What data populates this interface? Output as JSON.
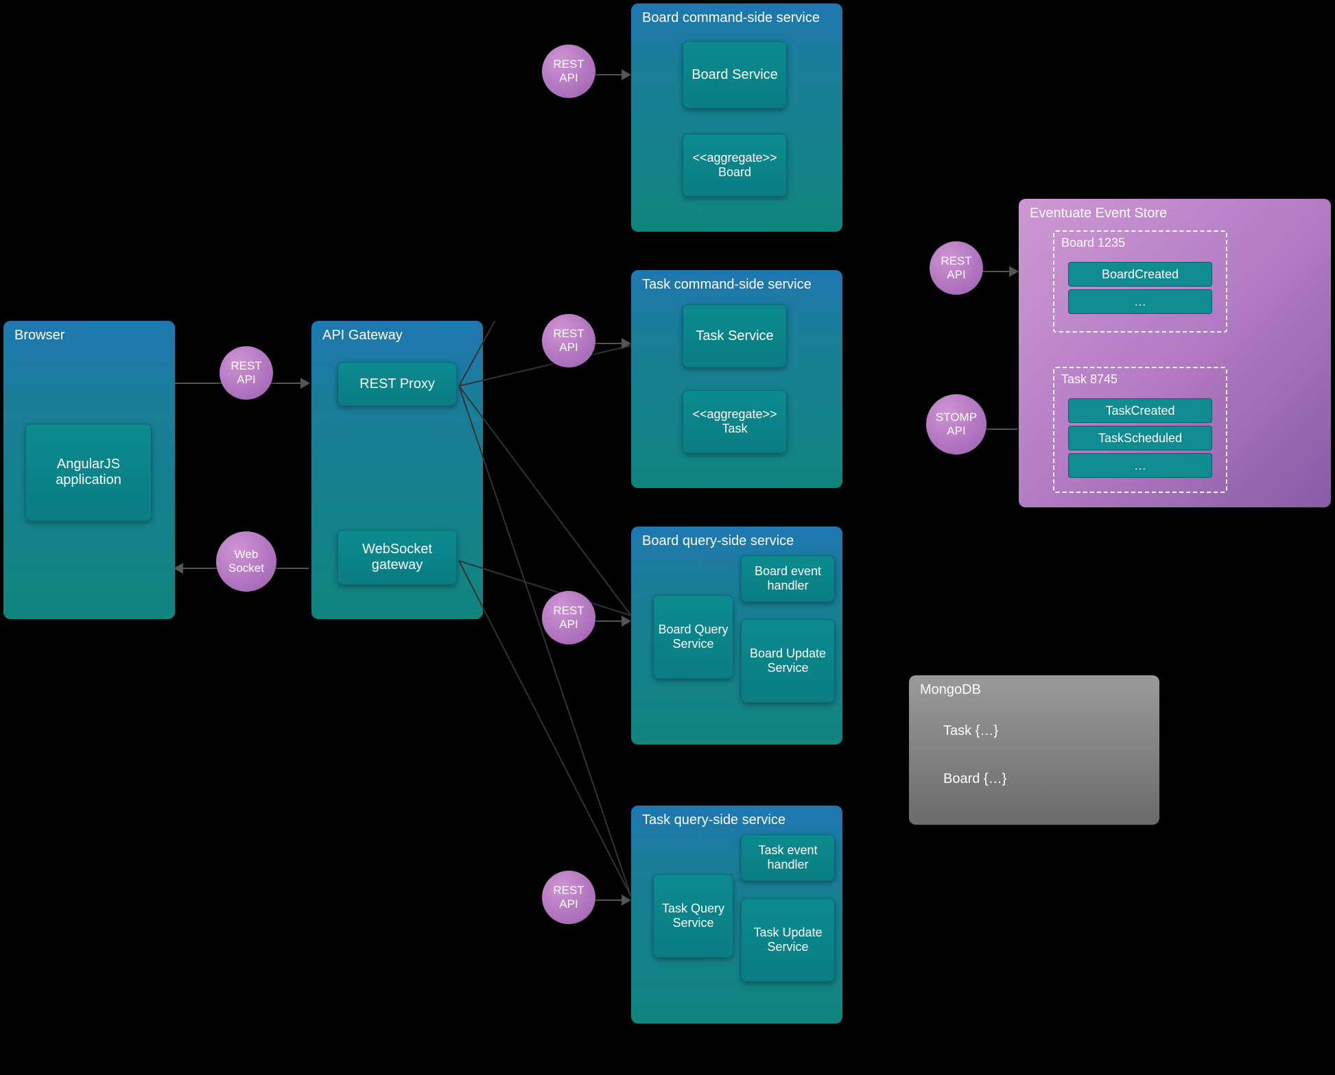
{
  "diagram": {
    "browser": {
      "title": "Browser",
      "app": "AngularJS application"
    },
    "gateway": {
      "title": "API Gateway",
      "rest_proxy": "REST Proxy",
      "ws_gateway": "WebSocket gateway"
    },
    "board_cmd": {
      "title": "Board command-side service",
      "svc": "Board Service",
      "stereotype": "<<aggregate>>",
      "agg": "Board"
    },
    "task_cmd": {
      "title": "Task command-side service",
      "svc": "Task Service",
      "stereotype": "<<aggregate>>",
      "agg": "Task"
    },
    "board_qry": {
      "title": "Board query-side service",
      "query": "Board Query Service",
      "handler": "Board event handler",
      "update": "Board Update Service"
    },
    "task_qry": {
      "title": "Task query-side service",
      "query": "Task Query Service",
      "handler": "Task event handler",
      "update": "Task Update Service"
    },
    "event_store": {
      "title": "Eventuate Event Store",
      "board_group": "Board 1235",
      "board_ev1": "BoardCreated",
      "board_more": "…",
      "task_group": "Task 8745",
      "task_ev1": "TaskCreated",
      "task_ev2": "TaskScheduled",
      "task_more": "…"
    },
    "mongodb": {
      "title": "MongoDB",
      "task": "Task  {…}",
      "board": "Board  {…}"
    },
    "badges": {
      "rest": "REST",
      "api": "API",
      "stomp": "STOMP",
      "web": "Web",
      "socket": "Socket"
    }
  }
}
